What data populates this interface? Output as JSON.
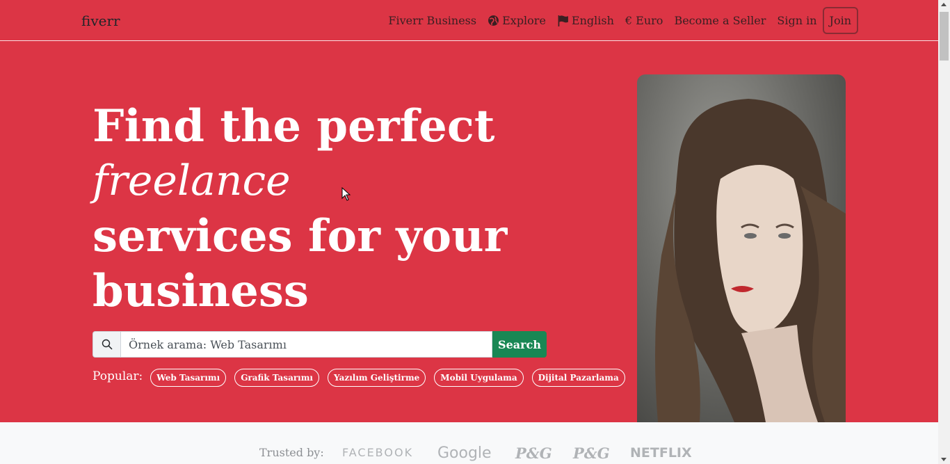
{
  "nav": {
    "logo": "fiverr",
    "business": "Fiverr Business",
    "explore": "Explore",
    "language": "English",
    "currency": "€ Euro",
    "become_seller": "Become a Seller",
    "sign_in": "Sign in",
    "join": "Join"
  },
  "hero": {
    "line1": "Find the perfect",
    "line2": "freelance",
    "line3": "services for your",
    "line4": "business",
    "search_placeholder": "Örnek arama: Web Tasarımı",
    "search_button": "Search",
    "popular_label": "Popular:",
    "popular_tags": [
      "Web Tasarımı",
      "Grafik Tasarımı",
      "Yazılım Geliştirme",
      "Mobil Uygulama",
      "Dijital Pazarlama"
    ]
  },
  "trusted": {
    "label": "Trusted by:",
    "brands": [
      "FACEBOOK",
      "Google",
      "P&G",
      "P&G",
      "NETFLIX"
    ]
  },
  "colors": {
    "hero_bg": "#dc3545",
    "search_button": "#198754"
  },
  "icons": {
    "explore": "globe-icon",
    "language": "flag-icon",
    "search": "search-icon"
  }
}
